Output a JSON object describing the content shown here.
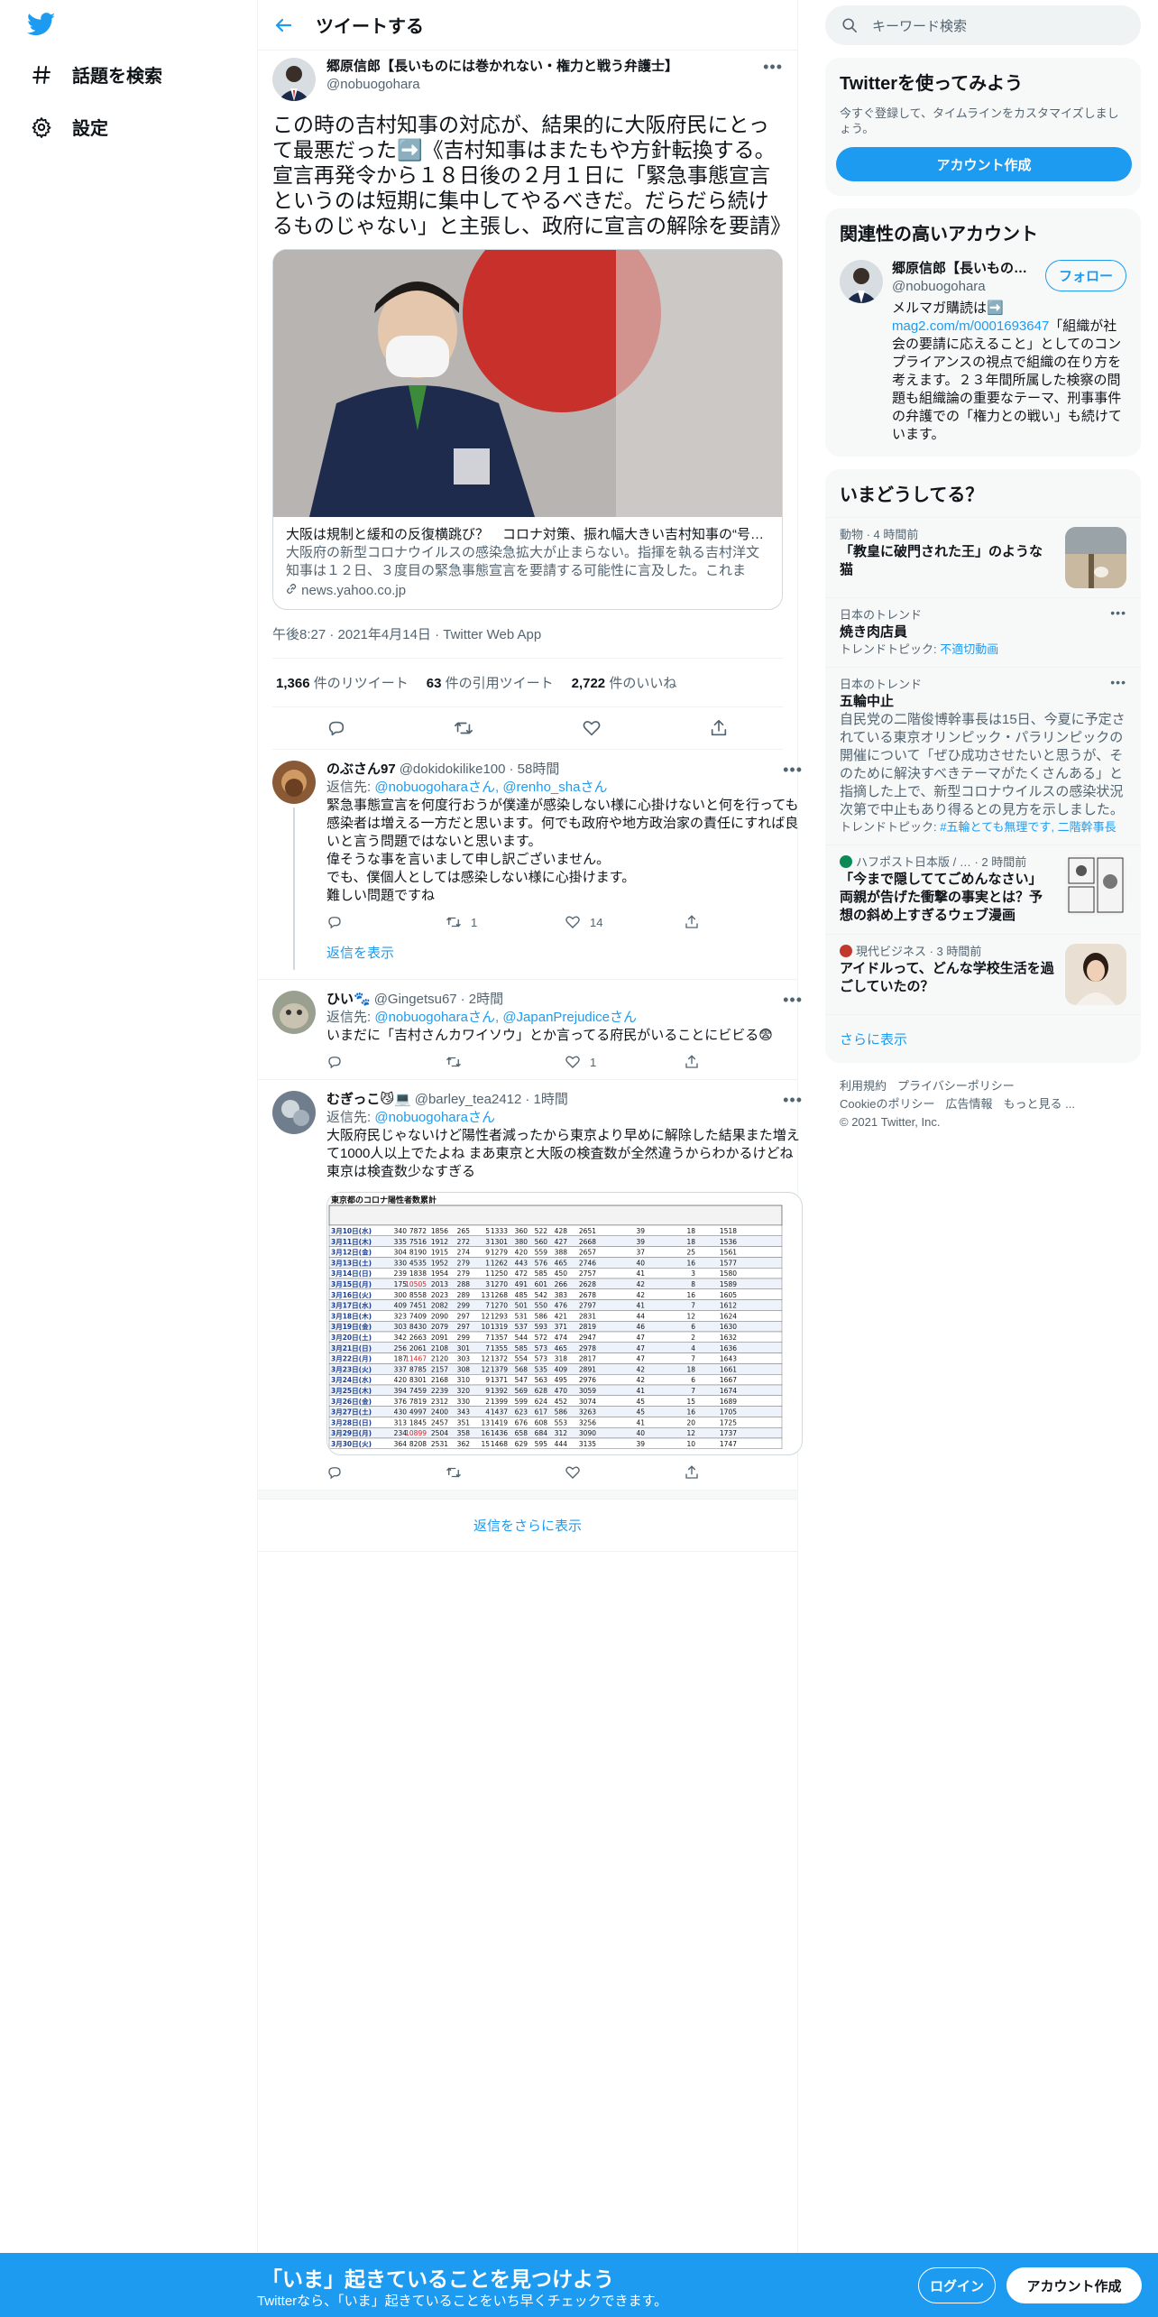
{
  "nav": {
    "items": [
      {
        "label": "話題を検索",
        "icon": "hashtag-icon"
      },
      {
        "label": "設定",
        "icon": "gear-icon"
      }
    ]
  },
  "header": {
    "title": "ツイートする"
  },
  "main_tweet": {
    "author_name": "郷原信郎【長いものには巻かれない・権力と戦う弁護士】",
    "author_handle": "@nobuogohara",
    "text": "この時の吉村知事の対応が、結果的に大阪府民にとって最悪だった➡️《吉村知事はまたもや方針転換する。宣言再発令から１８日後の２月１日に「緊急事態宣言というのは短期に集中してやるべきだ。だらだら続けるものじゃない」と主張し、政府に宣言の解除を要請》",
    "card": {
      "title": "大阪は規制と緩和の反復横跳び？　コロナ対策、振れ幅大きい吉村知事の“号…",
      "description": "大阪府の新型コロナウイルスの感染急拡大が止まらない。指揮を執る吉村洋文知事は１２日、３度目の緊急事態宣言を要請する可能性に言及した。これまで…",
      "domain": "news.yahoo.co.jp"
    },
    "timestamp": "午後8:27 · 2021年4月14日 · Twitter Web App",
    "stats": {
      "retweets": "1,366",
      "retweets_label": "件のリツイート",
      "quotes": "63",
      "quotes_label": "件の引用ツイート",
      "likes": "2,722",
      "likes_label": "件のいいね"
    }
  },
  "replies": [
    {
      "name": "のぶさん97",
      "handle": "@dokidokilike100",
      "time": "· 58時間",
      "replying_prefix": "返信先: ",
      "replying_to": "@nobuogoharaさん, @renho_shaさん",
      "text": "緊急事態宣言を何度行おうが僕達が感染しない様に心掛けないと何を行っても感染者は増える一方だと思います。何でも政府や地方政治家の責任にすれば良いと言う問題ではないと思います。\n偉そうな事を言いまして申し訳ございません。\nでも、僕個人としては感染しない様に心掛けます。\n難しい問題ですね",
      "retweets": "1",
      "likes": "14",
      "show_replies": "返信を表示"
    },
    {
      "name": "ひい🐾",
      "handle": "@Gingetsu67",
      "time": "· 2時間",
      "replying_prefix": "返信先: ",
      "replying_to": "@nobuogoharaさん, @JapanPrejudiceさん",
      "text": "いまだに「吉村さんカワイソウ」とか言ってる府民がいることにビビる😨",
      "retweets": "",
      "likes": "1"
    },
    {
      "name": "むぎっこ😼💻",
      "handle": "@barley_tea2412",
      "time": "· 1時間",
      "replying_prefix": "返信先: ",
      "replying_to": "@nobuogoharaさん",
      "text": "大阪府民じゃないけど陽性者減ったから東京より早めに解除した結果また増えて1000人以上でたよね まあ東京と大阪の検査数が全然違うからわかるけどね  東京は検査数少なすぎる",
      "retweets": "",
      "likes": ""
    }
  ],
  "table_image": {
    "title": "東京都のコロナ陽性者数累計",
    "rows": [
      [
        "3月10日(水)",
        "340",
        "7872",
        "1856",
        "265",
        "5",
        "1333",
        "360",
        "522",
        "428",
        "2651",
        "39",
        "18",
        "1518"
      ],
      [
        "3月11日(木)",
        "335",
        "7516",
        "1912",
        "272",
        "3",
        "1301",
        "380",
        "560",
        "427",
        "2668",
        "39",
        "18",
        "1536"
      ],
      [
        "3月12日(金)",
        "304",
        "8190",
        "1915",
        "274",
        "9",
        "1279",
        "420",
        "559",
        "388",
        "2657",
        "37",
        "25",
        "1561"
      ],
      [
        "3月13日(土)",
        "330",
        "4535",
        "1952",
        "279",
        "1",
        "1262",
        "443",
        "576",
        "465",
        "2746",
        "40",
        "16",
        "1577"
      ],
      [
        "3月14日(日)",
        "239",
        "1838",
        "1954",
        "279",
        "1",
        "1250",
        "472",
        "585",
        "450",
        "2757",
        "41",
        "3",
        "1580"
      ],
      [
        "3月15日(月)",
        "175",
        "10505",
        "2013",
        "288",
        "3",
        "1270",
        "491",
        "601",
        "266",
        "2628",
        "42",
        "8",
        "1589"
      ],
      [
        "3月16日(火)",
        "300",
        "8558",
        "2023",
        "289",
        "13",
        "1268",
        "485",
        "542",
        "383",
        "2678",
        "42",
        "16",
        "1605"
      ],
      [
        "3月17日(水)",
        "409",
        "7451",
        "2082",
        "299",
        "7",
        "1270",
        "501",
        "550",
        "476",
        "2797",
        "41",
        "7",
        "1612"
      ],
      [
        "3月18日(木)",
        "323",
        "7409",
        "2090",
        "297",
        "12",
        "1293",
        "531",
        "586",
        "421",
        "2831",
        "44",
        "12",
        "1624"
      ],
      [
        "3月19日(金)",
        "303",
        "8430",
        "2079",
        "297",
        "10",
        "1319",
        "537",
        "593",
        "371",
        "2819",
        "46",
        "6",
        "1630"
      ],
      [
        "3月20日(土)",
        "342",
        "2663",
        "2091",
        "299",
        "7",
        "1357",
        "544",
        "572",
        "474",
        "2947",
        "47",
        "2",
        "1632"
      ],
      [
        "3月21日(日)",
        "256",
        "2061",
        "2108",
        "301",
        "7",
        "1355",
        "585",
        "573",
        "465",
        "2978",
        "47",
        "4",
        "1636"
      ],
      [
        "3月22日(月)",
        "187",
        "11467",
        "2120",
        "303",
        "12",
        "1372",
        "554",
        "573",
        "318",
        "2817",
        "47",
        "7",
        "1643"
      ],
      [
        "3月23日(火)",
        "337",
        "8785",
        "2157",
        "308",
        "12",
        "1379",
        "568",
        "535",
        "409",
        "2891",
        "42",
        "18",
        "1661"
      ],
      [
        "3月24日(水)",
        "420",
        "8301",
        "2168",
        "310",
        "9",
        "1371",
        "547",
        "563",
        "495",
        "2976",
        "42",
        "6",
        "1667"
      ],
      [
        "3月25日(木)",
        "394",
        "7459",
        "2239",
        "320",
        "9",
        "1392",
        "569",
        "628",
        "470",
        "3059",
        "41",
        "7",
        "1674"
      ],
      [
        "3月26日(金)",
        "376",
        "7819",
        "2312",
        "330",
        "2",
        "1399",
        "599",
        "624",
        "452",
        "3074",
        "45",
        "15",
        "1689"
      ],
      [
        "3月27日(土)",
        "430",
        "4997",
        "2400",
        "343",
        "4",
        "1437",
        "623",
        "617",
        "586",
        "3263",
        "45",
        "16",
        "1705"
      ],
      [
        "3月28日(日)",
        "313",
        "1845",
        "2457",
        "351",
        "13",
        "1419",
        "676",
        "608",
        "553",
        "3256",
        "41",
        "20",
        "1725"
      ],
      [
        "3月29日(月)",
        "234",
        "10899",
        "2504",
        "358",
        "16",
        "1436",
        "658",
        "684",
        "312",
        "3090",
        "40",
        "12",
        "1737"
      ],
      [
        "3月30日(火)",
        "364",
        "8208",
        "2531",
        "362",
        "15",
        "1468",
        "629",
        "595",
        "444",
        "3135",
        "39",
        "10",
        "1747"
      ]
    ]
  },
  "show_more_replies": "返信をさらに表示",
  "right": {
    "search_placeholder": "キーワード検索",
    "join": {
      "title": "Twitterを使ってみよう",
      "subtitle": "今すぐ登録して、タイムラインをカスタマイズしましょう。",
      "button": "アカウント作成"
    },
    "relevant": {
      "title": "関連性の高いアカウント",
      "name": "郷原信郎【長いもの…",
      "handle": "@nobuogohara",
      "follow": "フォロー",
      "bio_1": "メルマガ購読は➡️",
      "bio_link": "mag2.com/m/0001693647",
      "bio_2": "「組織が社会の要請に応えること」としてのコンプライアンスの視点で組織の在り方を考えます。２３年間所属した検察の問題も組織論の重要なテーマ、刑事事件の弁護での「権力との戦い」も続けています。"
    },
    "trends": {
      "title": "いまどうしてる？",
      "items": [
        {
          "meta": "動物 · 4 時間前",
          "title": "「教皇に破門された王」のような猫",
          "thumb": "cat"
        },
        {
          "meta": "日本のトレンド",
          "title": "焼き肉店員",
          "sub_prefix": "トレンドトピック: ",
          "sub_link": "不適切動画"
        },
        {
          "meta": "日本のトレンド",
          "title": "五輪中止",
          "desc": "自民党の二階俊博幹事長は15日、今夏に予定されている東京オリンピック・パラリンピックの開催について「ぜひ成功させたいと思うが、そのために解決すべきテーマがたくさんある」と指摘した上で、新型コロナウイルスの感染状況次第で中止もあり得るとの見方を示しました。",
          "sub_prefix": "トレンドトピック: ",
          "sub_link": "#五輪とても無理です, 二階幹事長"
        },
        {
          "meta": "ハフポスト日本版 / … · 2 時間前",
          "title": "「今まで隠しててごめんなさい」両親が告げた衝撃の事実とは？予想の斜め上すぎるウェブ漫画",
          "thumb": "manga"
        },
        {
          "meta": "現代ビジネス · 3 時間前",
          "title": "アイドルって、どんな学校生活を過ごしていたの？",
          "thumb": "idol"
        }
      ],
      "show_more": "さらに表示"
    },
    "footer": {
      "links": [
        "利用規約",
        "プライバシーポリシー",
        "Cookieのポリシー",
        "広告情報",
        "もっと見る ..."
      ],
      "copyright": "© 2021 Twitter, Inc."
    }
  },
  "bottom_bar": {
    "title": "「いま」起きていることを見つけよう",
    "subtitle": "Twitterなら、「いま」起きていることをいち早くチェックできます。",
    "login": "ログイン",
    "signup": "アカウント作成"
  },
  "colors": {
    "accent": "#1d9bf0",
    "text": "#0f1419",
    "secondary": "#536471"
  }
}
